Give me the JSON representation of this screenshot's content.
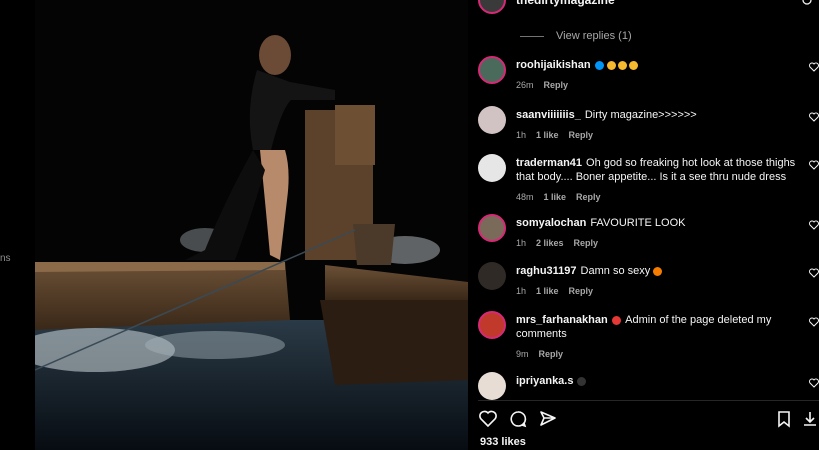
{
  "sidebar": {
    "fragment": "ns"
  },
  "post": {
    "author": "thedirtymagazine",
    "likes": "933 likes"
  },
  "replies": {
    "view_label": "View replies (1)"
  },
  "comments": [
    {
      "user": "roohijaikishan",
      "text": "",
      "time": "26m",
      "likes": "",
      "reply": "Reply",
      "verified": true,
      "emoji": "clap"
    },
    {
      "user": "saanviiiiiiis_",
      "text": "Dirty magazine>>>>>>",
      "time": "1h",
      "likes": "1 like",
      "reply": "Reply"
    },
    {
      "user": "traderman41",
      "text": "Oh god so freaking hot look at those thighs that body.... Boner appetite... Is it a see thru nude dress",
      "time": "48m",
      "likes": "1 like",
      "reply": "Reply"
    },
    {
      "user": "somyalochan",
      "text": "FAVOURITE LOOK",
      "time": "1h",
      "likes": "2 likes",
      "reply": "Reply"
    },
    {
      "user": "raghu31197",
      "text": "Damn so sexy",
      "time": "1h",
      "likes": "1 like",
      "reply": "Reply",
      "emoji": "fire"
    },
    {
      "user": "mrs_farhanakhan",
      "text": "Admin of the page deleted my comments",
      "time": "9m",
      "likes": "",
      "reply": "Reply",
      "emoji": "angry"
    },
    {
      "user": "ipriyanka.s",
      "text": "",
      "time": "",
      "likes": "",
      "reply": "",
      "emoji": "black-heart"
    }
  ],
  "icons": {
    "like": "heart-icon",
    "comment": "comment-icon",
    "share": "send-icon",
    "save": "bookmark-icon",
    "download": "download-icon"
  }
}
